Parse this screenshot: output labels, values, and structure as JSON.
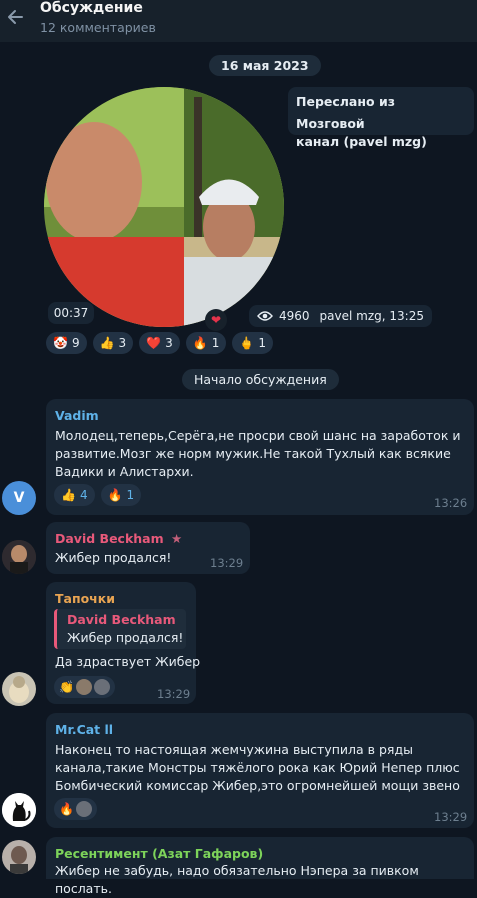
{
  "header": {
    "title": "Обсуждение",
    "subtitle": "12 комментариев"
  },
  "date_pill": "16 мая 2023",
  "forward": {
    "line1": "Переслано из Мозговой",
    "line2": "канал (pavel mzg)"
  },
  "video": {
    "duration": "00:37",
    "views": "4960",
    "author_time": "pavel mzg, 13:25"
  },
  "post_reactions": [
    {
      "emoji": "🤡",
      "count": "9"
    },
    {
      "emoji": "👍",
      "count": "3"
    },
    {
      "emoji": "❤️",
      "count": "3"
    },
    {
      "emoji": "🔥",
      "count": "1"
    },
    {
      "emoji": "🖕",
      "count": "1"
    }
  ],
  "discussion_pill": "Начало обсуждения",
  "messages": [
    {
      "name": "Vadim",
      "name_color": "#5fb2e8",
      "lines": [
        "Молодец,теперь,Серёга,не просри свой шанс на заработок и",
        "развитие.Мозг же норм мужик.Не такой Тухлый как всякие",
        "Вадики и Алистархи."
      ],
      "reactions": [
        {
          "emoji": "👍",
          "count": "4"
        },
        {
          "emoji": "🔥",
          "count": "1"
        }
      ],
      "time": "13:26",
      "avatar_letter": "V"
    },
    {
      "name": "David Beckham",
      "name_color": "#e8597a",
      "star": "★",
      "lines": [
        "Жибер продался!"
      ],
      "time": "13:29"
    },
    {
      "name": "Тапочки",
      "name_color": "#e8a452",
      "quote_name": "David Beckham",
      "quote_text": "Жибер продался!",
      "lines": [
        "Да здраствует Жибер"
      ],
      "reactions": [
        {
          "emoji": "👏",
          "count": ""
        }
      ],
      "time": "13:29"
    },
    {
      "name": "Mr.Cat ll",
      "name_color": "#5fb2e8",
      "lines": [
        "Наконец то настоящая жемчужина выступила в ряды",
        "канала,такие Монстры тяжёлого рока как Юрий Непер плюс",
        "Бомбический комиссар Жибер,это огромнейшей мощи звено"
      ],
      "reactions": [
        {
          "emoji": "🔥",
          "count": ""
        }
      ],
      "time": "13:29"
    },
    {
      "name": "Ресентимент (Азат Гафаров)",
      "name_color": "#7dd35a",
      "lines": [
        "Жибер не забудь, надо обязательно Нэпера за пивком послать."
      ]
    }
  ],
  "colors": {
    "background": "#0e1621",
    "bubble": "#182533",
    "header": "#17212b"
  }
}
